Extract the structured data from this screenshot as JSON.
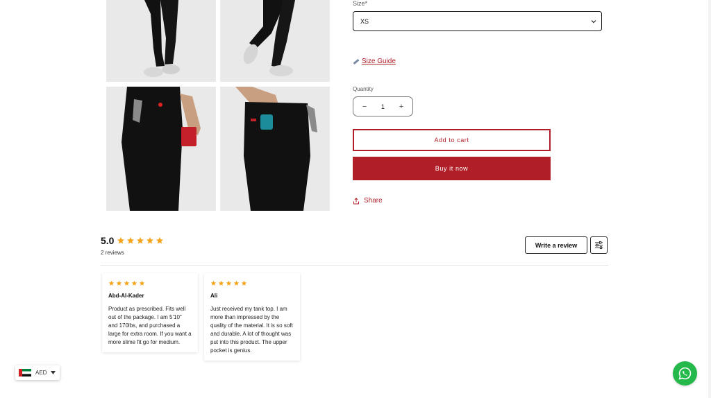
{
  "size": {
    "label": "Size*",
    "selected": "XS"
  },
  "size_guide": {
    "label": "Size Guide",
    "icon": "ruler-icon"
  },
  "quantity": {
    "label": "Quantity",
    "value": "1",
    "minus": "−",
    "plus": "+"
  },
  "buttons": {
    "add_to_cart": "Add to cart",
    "buy_now": "Buy it now",
    "share": "Share"
  },
  "reviews": {
    "average": "5.0",
    "stars": 5,
    "count_label": "2 reviews",
    "write_review": "Write a review",
    "items": [
      {
        "author": "Abd-Al-Kader",
        "stars": 5,
        "body": "Product as prescribed. Fits well out of the package. I am 5'10\" and 170lbs, and purchased a large for extra room. If you want a more slime fit go for medium."
      },
      {
        "author": "Ali",
        "stars": 5,
        "body": "Just received my tank top. I am more than impressed by the quality of the material. It is so soft and durable. A lot of thought was put into this product. The upper pocket is genius."
      }
    ]
  },
  "currency": {
    "code": "AED",
    "flag": "uae-flag-icon"
  },
  "colors": {
    "accent": "#b01e28",
    "star": "#f4a51c",
    "whatsapp": "#25b84a"
  }
}
